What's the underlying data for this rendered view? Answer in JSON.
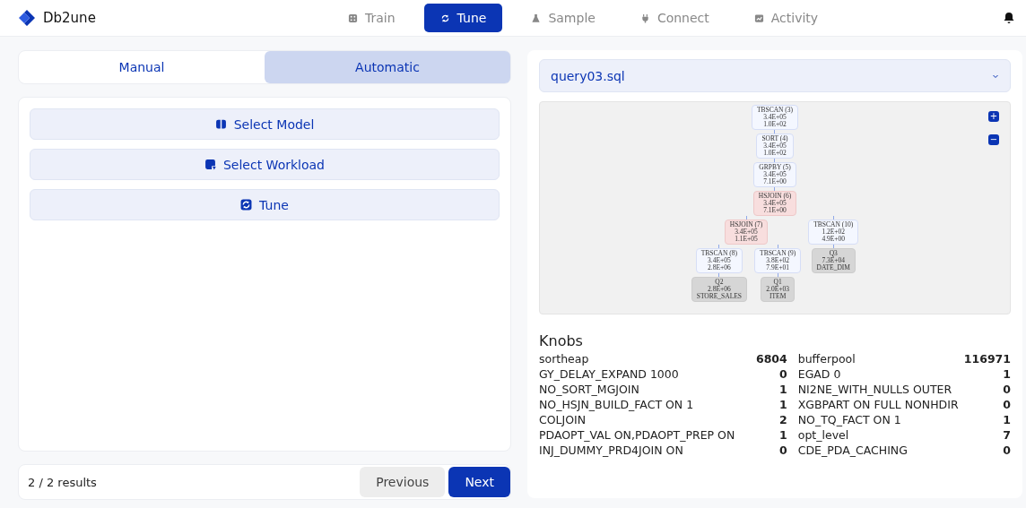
{
  "app": {
    "name": "Db2une"
  },
  "nav": [
    {
      "label": "Train",
      "selected": false
    },
    {
      "label": "Tune",
      "selected": true
    },
    {
      "label": "Sample",
      "selected": false
    },
    {
      "label": "Connect",
      "selected": false
    },
    {
      "label": "Activity",
      "selected": false
    }
  ],
  "mode_tabs": [
    {
      "label": "Manual",
      "selected": false
    },
    {
      "label": "Automatic",
      "selected": true
    }
  ],
  "actions": [
    {
      "label": "Select Model"
    },
    {
      "label": "Select Workload"
    },
    {
      "label": "Tune"
    }
  ],
  "results": "2 / 2 results",
  "pager": [
    {
      "label": "Previous",
      "kind": "secondary"
    },
    {
      "label": "Next",
      "kind": "primary"
    }
  ],
  "query_select": {
    "value": "query03.sql"
  },
  "plan": {
    "kind": "op",
    "lines": [
      "TBSCAN (3)",
      "3.4E+05",
      "1.0E+02"
    ],
    "children": [
      {
        "kind": "op",
        "lines": [
          "SORT (4)",
          "3.4E+05",
          "1.0E+02"
        ],
        "children": [
          {
            "kind": "op",
            "lines": [
              "GRPBY (5)",
              "3.4E+05",
              "7.1E+00"
            ],
            "children": [
              {
                "kind": "join",
                "lines": [
                  "HSJOIN (6)",
                  "3.4E+05",
                  "7.1E+00"
                ],
                "children": [
                  {
                    "kind": "join",
                    "lines": [
                      "HSJOIN (7)",
                      "3.4E+05",
                      "1.1E+05"
                    ],
                    "children": [
                      {
                        "kind": "op",
                        "lines": [
                          "TBSCAN (8)",
                          "3.4E+05",
                          "2.8E+06"
                        ],
                        "children": [
                          {
                            "kind": "table",
                            "lines": [
                              "Q2",
                              "2.8E+06",
                              "STORE_SALES"
                            ]
                          }
                        ]
                      },
                      {
                        "kind": "op",
                        "lines": [
                          "TBSCAN (9)",
                          "3.8E+02",
                          "7.9E+01"
                        ],
                        "children": [
                          {
                            "kind": "table",
                            "lines": [
                              "Q1",
                              "2.0E+03",
                              "ITEM"
                            ]
                          }
                        ]
                      }
                    ]
                  },
                  {
                    "kind": "op",
                    "lines": [
                      "TBSCAN (10)",
                      "1.2E+02",
                      "4.9E+00"
                    ],
                    "children": [
                      {
                        "kind": "table",
                        "lines": [
                          "Q3",
                          "7.3E+04",
                          "DATE_DIM"
                        ]
                      }
                    ]
                  }
                ]
              }
            ]
          }
        ]
      }
    ]
  },
  "zoom_controls": [
    "+",
    "−"
  ],
  "knobs": {
    "title": "Knobs",
    "items": [
      {
        "name": "sortheap",
        "value": "6804"
      },
      {
        "name": "bufferpool",
        "value": "116971"
      },
      {
        "name": "GY_DELAY_EXPAND 1000",
        "value": "0"
      },
      {
        "name": "EGAD 0",
        "value": "1"
      },
      {
        "name": "NO_SORT_MGJOIN",
        "value": "1"
      },
      {
        "name": "NI2NE_WITH_NULLS OUTER",
        "value": "0"
      },
      {
        "name": "NO_HSJN_BUILD_FACT ON 1",
        "value": "1"
      },
      {
        "name": "XGBPART ON FULL NONHDIR",
        "value": "0"
      },
      {
        "name": "COLJOIN",
        "value": "2"
      },
      {
        "name": "NO_TQ_FACT ON 1",
        "value": "1"
      },
      {
        "name": "PDAOPT_VAL ON,PDAOPT_PREP ON",
        "value": "1"
      },
      {
        "name": "opt_level",
        "value": "7"
      },
      {
        "name": "INJ_DUMMY_PRD4JOIN ON",
        "value": "0"
      },
      {
        "name": "CDE_PDA_CACHING",
        "value": "0"
      }
    ]
  }
}
